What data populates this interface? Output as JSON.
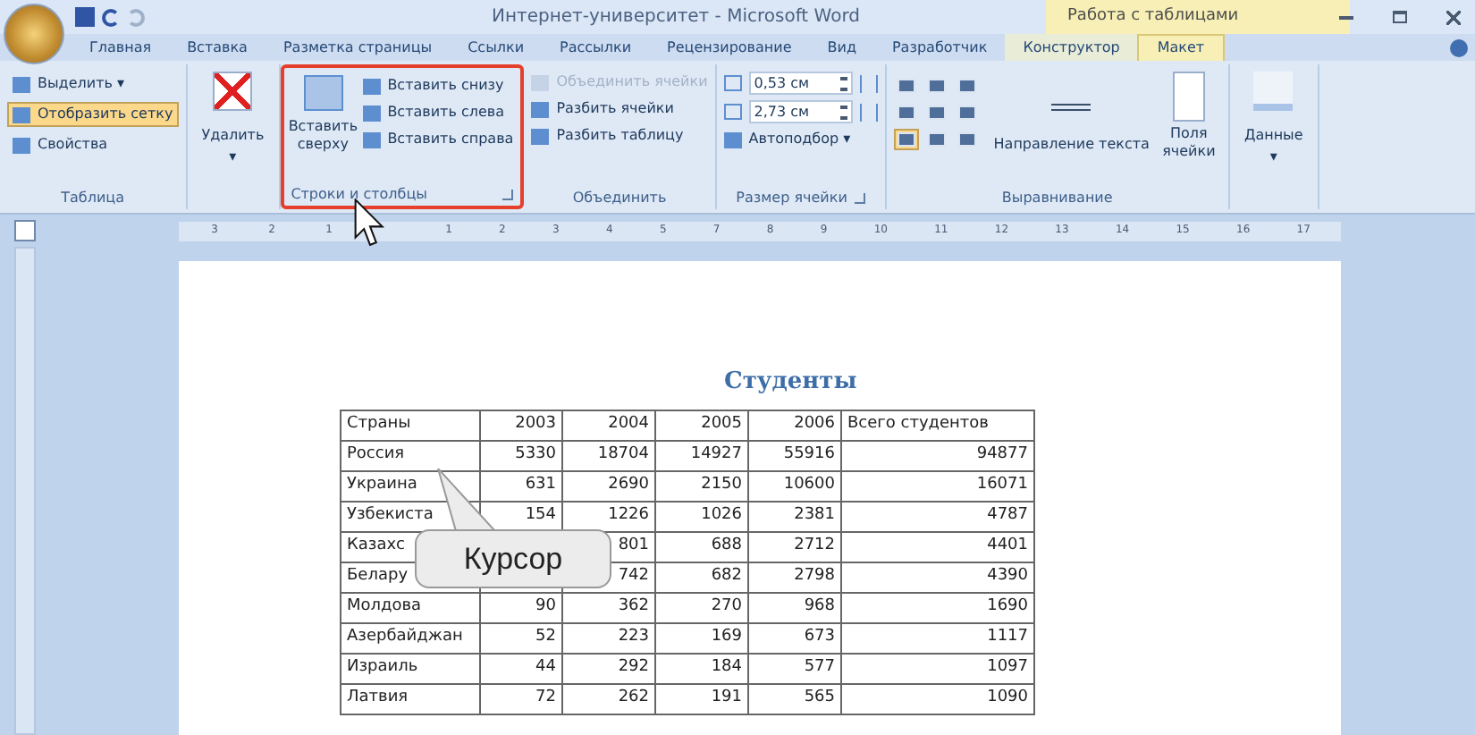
{
  "window": {
    "title": "Интернет-университет - Microsoft Word",
    "context_title": "Работа с таблицами"
  },
  "tabs": [
    {
      "label": "Главная",
      "selected": false,
      "kind": "main"
    },
    {
      "label": "Вставка",
      "selected": false,
      "kind": "main"
    },
    {
      "label": "Разметка страницы",
      "selected": false,
      "kind": "main"
    },
    {
      "label": "Ссылки",
      "selected": false,
      "kind": "main"
    },
    {
      "label": "Рассылки",
      "selected": false,
      "kind": "main"
    },
    {
      "label": "Рецензирование",
      "selected": false,
      "kind": "main"
    },
    {
      "label": "Вид",
      "selected": false,
      "kind": "main"
    },
    {
      "label": "Разработчик",
      "selected": false,
      "kind": "main"
    },
    {
      "label": "Конструктор",
      "selected": false,
      "kind": "context"
    },
    {
      "label": "Макет",
      "selected": true,
      "kind": "context"
    }
  ],
  "table_group": {
    "title": "Таблица",
    "items": [
      {
        "label": "Выделить ▾",
        "selected": false
      },
      {
        "label": "Отобразить сетку",
        "selected": true
      },
      {
        "label": "Свойства",
        "selected": false
      }
    ]
  },
  "delete_button": {
    "label": "Удалить",
    "caret": "▾"
  },
  "rows_group": {
    "title": "Строки и столбцы",
    "highlighted": true,
    "insert_above": "Вставить сверху",
    "items": [
      "Вставить снизу",
      "Вставить слева",
      "Вставить справа"
    ]
  },
  "merge_group": {
    "title": "Объединить",
    "items": [
      {
        "label": "Объединить ячейки",
        "disabled": true
      },
      {
        "label": "Разбить ячейки",
        "disabled": false
      },
      {
        "label": "Разбить таблицу",
        "disabled": false
      }
    ]
  },
  "size_group": {
    "title": "Размер ячейки",
    "height": "0,53 см",
    "width": "2,73 см",
    "autofit": "Автоподбор ▾"
  },
  "align_group": {
    "title": "Выравнивание",
    "cells": [
      {
        "selected": false
      },
      {
        "selected": false
      },
      {
        "selected": false
      },
      {
        "selected": false
      },
      {
        "selected": false
      },
      {
        "selected": false
      },
      {
        "selected": true
      },
      {
        "selected": false
      },
      {
        "selected": false
      }
    ],
    "text_direction": "Направление текста",
    "margins": "Поля ячейки"
  },
  "data_group": {
    "label": "Данные",
    "caret": "▾"
  },
  "ruler": [
    "3",
    "2",
    "1",
    "1",
    "2",
    "3",
    "4",
    "5",
    "7",
    "8",
    "9",
    "10",
    "11",
    "12",
    "13",
    "14",
    "15",
    "16",
    "17"
  ],
  "document": {
    "heading": "Студенты",
    "table": {
      "columns": [
        "Страны",
        "2003",
        "2004",
        "2005",
        "2006",
        "Всего студентов"
      ],
      "rows": [
        [
          "Россия",
          "5330",
          "18704",
          "14927",
          "55916",
          "94877"
        ],
        [
          "Украина",
          "631",
          "2690",
          "2150",
          "10600",
          "16071"
        ],
        [
          "Узбекиста",
          "154",
          "1226",
          "1026",
          "2381",
          "4787"
        ],
        [
          "Казахс",
          null,
          "801",
          "688",
          "2712",
          "4401"
        ],
        [
          "Белару",
          null,
          "742",
          "682",
          "2798",
          "4390"
        ],
        [
          "Молдова",
          "90",
          "362",
          "270",
          "968",
          "1690"
        ],
        [
          "Азербайджан",
          "52",
          "223",
          "169",
          "673",
          "1117"
        ],
        [
          "Израиль",
          "44",
          "292",
          "184",
          "577",
          "1097"
        ],
        [
          "Латвия",
          "72",
          "262",
          "191",
          "565",
          "1090"
        ]
      ]
    }
  },
  "callout": {
    "text": "Курсор"
  }
}
